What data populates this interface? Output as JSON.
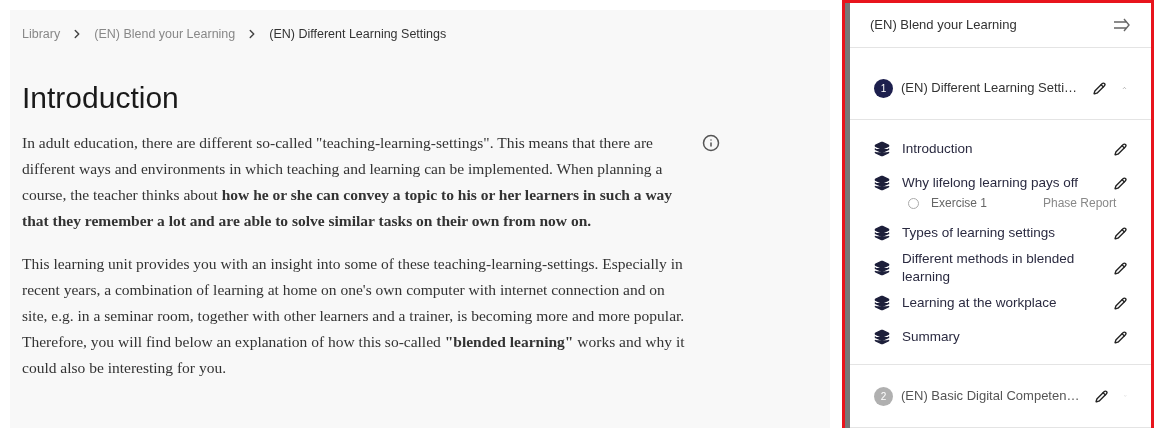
{
  "breadcrumb": [
    {
      "label": "Library",
      "current": false
    },
    {
      "label": "(EN) Blend your Learning",
      "current": false
    },
    {
      "label": "(EN) Different Learning Settings",
      "current": true
    }
  ],
  "title": "Introduction",
  "paragraphs": [
    "In adult education, there are different so-called \"teaching-learning-settings\". This means that there are different ways and environments in which teaching and learning can be implemented. When planning a course, the teacher thinks about **how he or she can convey a topic to his or her learners in such a way that they remember a lot and are able to solve similar tasks on their own from now on.**",
    "This learning unit provides you with an insight into some of these teaching-learning-settings. Especially in recent years, a combination of learning at home on one's own computer with internet connection and on site, e.g. in a seminar room, together with other learners and a trainer, is becoming more and more popular. Therefore, you will find below an explanation of how this so-called **\"blended learning\"** works and why it could also be interesting for you."
  ],
  "sidebar": {
    "title": "(EN) Blend your Learning",
    "chapters": [
      {
        "number": "1",
        "title": "(EN) Different Learning Setti…",
        "expanded": true,
        "lessons": [
          {
            "title": "Introduction"
          },
          {
            "title": "Why lifelong learning pays off",
            "exercises": [
              {
                "title": "Exercise 1",
                "checked": false,
                "tag": "Phase Report"
              }
            ]
          },
          {
            "title": "Types of learning settings"
          },
          {
            "title": "Different methods in blended learning"
          },
          {
            "title": "Learning at the workplace"
          },
          {
            "title": "Summary"
          }
        ]
      },
      {
        "number": "2",
        "title": "(EN) Basic Digital Competen…",
        "expanded": false
      }
    ]
  }
}
